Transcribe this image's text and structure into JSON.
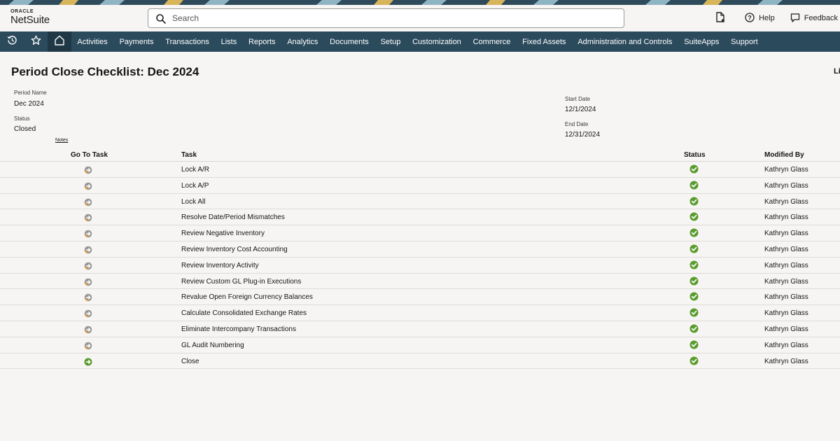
{
  "header": {
    "logo_top": "ORACLE",
    "logo_bottom": "NetSuite",
    "search_placeholder": "Search",
    "help_label": "Help",
    "feedback_label": "Feedback"
  },
  "nav": {
    "items": [
      "Activities",
      "Payments",
      "Transactions",
      "Lists",
      "Reports",
      "Analytics",
      "Documents",
      "Setup",
      "Customization",
      "Commerce",
      "Fixed Assets",
      "Administration and Controls",
      "SuiteApps",
      "Support"
    ]
  },
  "page": {
    "title": "Period Close Checklist: Dec 2024",
    "edge_text": "Li"
  },
  "fields": {
    "period_name_label": "Period Name",
    "period_name_value": "Dec 2024",
    "status_label": "Status",
    "status_value": "Closed",
    "notes_label": "Notes",
    "start_date_label": "Start Date",
    "start_date_value": "12/1/2024",
    "end_date_label": "End Date",
    "end_date_value": "12/31/2024"
  },
  "table": {
    "headers": {
      "goto": "Go To Task",
      "task": "Task",
      "status": "Status",
      "modified_by": "Modified By"
    },
    "rows": [
      {
        "task": "Lock A/R",
        "modified_by": "Kathryn Glass",
        "goto_icon": "go-to-task-icon",
        "status_icon": "check-circle-icon"
      },
      {
        "task": "Lock A/P",
        "modified_by": "Kathryn Glass",
        "goto_icon": "go-to-task-icon",
        "status_icon": "check-circle-icon"
      },
      {
        "task": "Lock All",
        "modified_by": "Kathryn Glass",
        "goto_icon": "go-to-task-icon",
        "status_icon": "check-circle-icon"
      },
      {
        "task": "Resolve Date/Period Mismatches",
        "modified_by": "Kathryn Glass",
        "goto_icon": "go-to-task-icon",
        "status_icon": "check-circle-icon"
      },
      {
        "task": "Review Negative Inventory",
        "modified_by": "Kathryn Glass",
        "goto_icon": "go-to-task-icon",
        "status_icon": "check-circle-icon"
      },
      {
        "task": "Review Inventory Cost Accounting",
        "modified_by": "Kathryn Glass",
        "goto_icon": "go-to-task-icon",
        "status_icon": "check-circle-icon"
      },
      {
        "task": "Review Inventory Activity",
        "modified_by": "Kathryn Glass",
        "goto_icon": "go-to-task-icon",
        "status_icon": "check-circle-icon"
      },
      {
        "task": "Review Custom GL Plug-in Executions",
        "modified_by": "Kathryn Glass",
        "goto_icon": "go-to-task-icon",
        "status_icon": "check-circle-icon"
      },
      {
        "task": "Revalue Open Foreign Currency Balances",
        "modified_by": "Kathryn Glass",
        "goto_icon": "go-to-task-icon",
        "status_icon": "check-circle-icon"
      },
      {
        "task": "Calculate Consolidated Exchange Rates",
        "modified_by": "Kathryn Glass",
        "goto_icon": "go-to-task-icon",
        "status_icon": "check-circle-icon"
      },
      {
        "task": "Eliminate Intercompany Transactions",
        "modified_by": "Kathryn Glass",
        "goto_icon": "go-to-task-icon",
        "status_icon": "check-circle-icon"
      },
      {
        "task": "GL Audit Numbering",
        "modified_by": "Kathryn Glass",
        "goto_icon": "go-to-task-icon",
        "status_icon": "check-circle-icon"
      },
      {
        "task": "Close",
        "modified_by": "Kathryn Glass",
        "goto_icon": "go-arrow-green-icon",
        "status_icon": "check-circle-icon"
      }
    ]
  },
  "colors": {
    "nav_bg": "#2b4a5c",
    "check_green": "#5a9b2e",
    "goto_orange": "#e0a030"
  }
}
